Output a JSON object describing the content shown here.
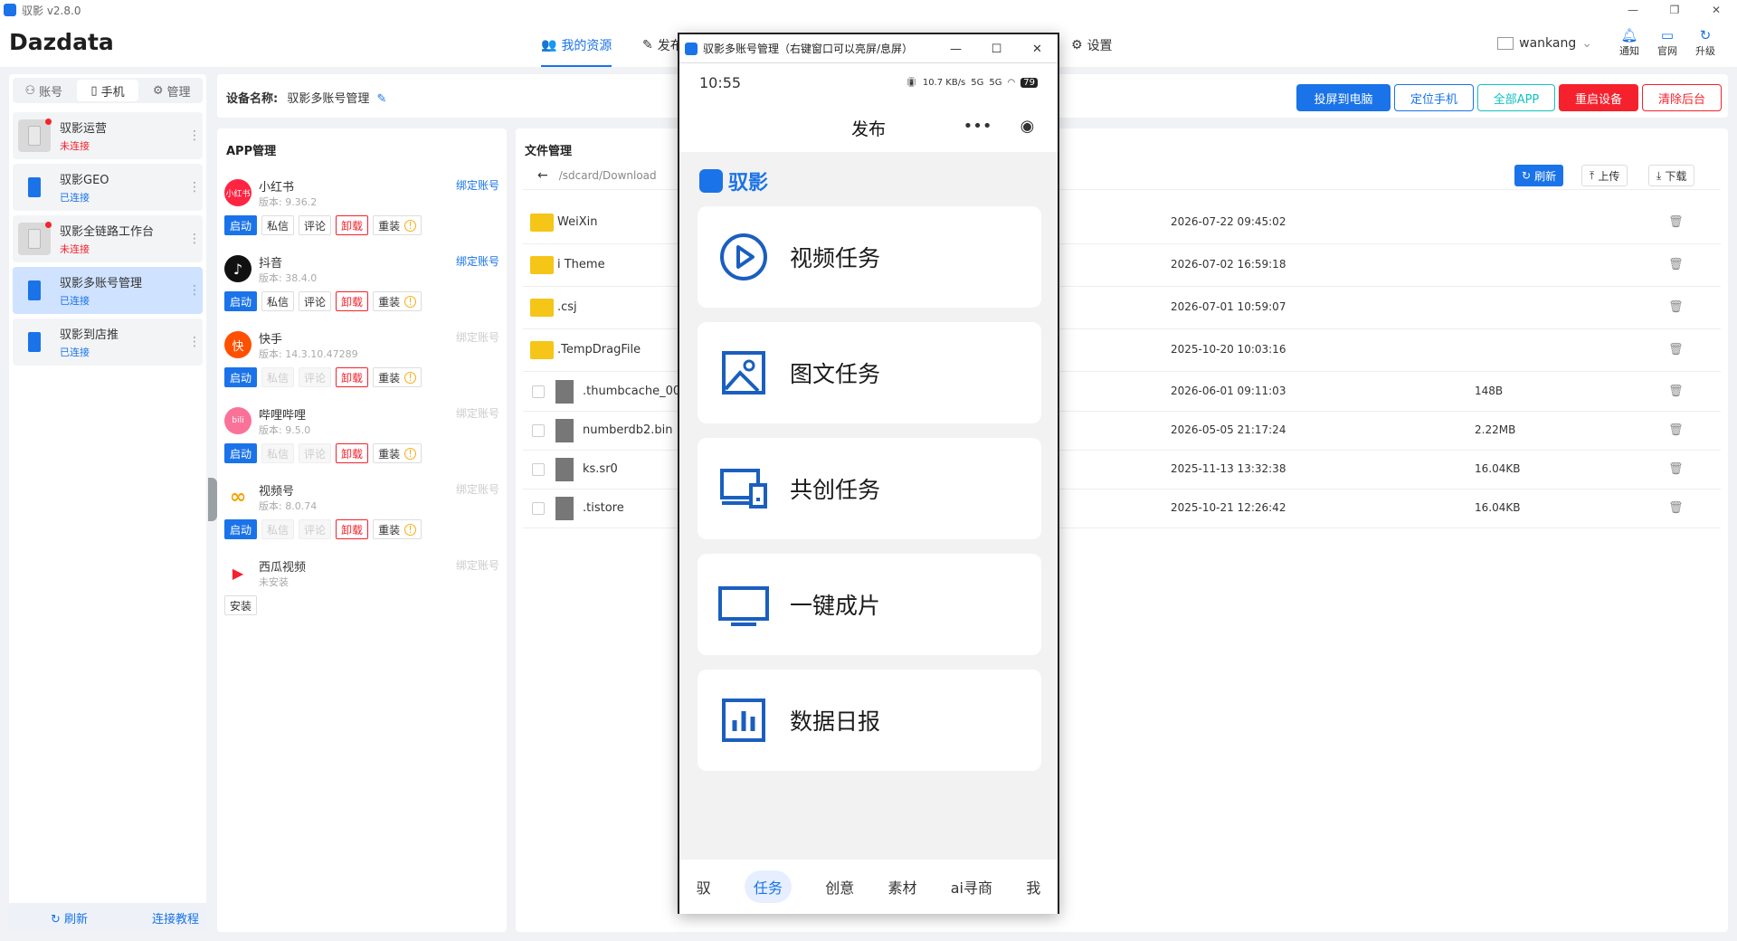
{
  "window": {
    "title": "驭影 v2.8.0",
    "controls": [
      "—",
      "❐",
      "✕"
    ]
  },
  "header": {
    "brand": "Dazdata",
    "nav": [
      {
        "label": "我的资源",
        "icon": "users-icon"
      },
      {
        "label": "发布",
        "icon": "publish-icon"
      },
      {
        "label": "设置",
        "icon": "gear-icon"
      }
    ],
    "user": "wankang",
    "icons": [
      {
        "label": "通知",
        "icon": "bell-icon"
      },
      {
        "label": "官网",
        "icon": "message-icon"
      },
      {
        "label": "升级",
        "icon": "refresh-icon"
      }
    ]
  },
  "left": {
    "tabs": [
      "账号",
      "手机",
      "管理"
    ],
    "devices": [
      {
        "name": "驭影运营",
        "status": "未连接",
        "online": false
      },
      {
        "name": "驭影GEO",
        "status": "已连接",
        "online": true
      },
      {
        "name": "驭影全链路工作台",
        "status": "未连接",
        "online": false
      },
      {
        "name": "驭影多账号管理",
        "status": "已连接",
        "online": true
      },
      {
        "name": "驭影到店推",
        "status": "已连接",
        "online": true
      }
    ],
    "refresh": "刷新",
    "tutorial": "连接教程"
  },
  "device_bar": {
    "label": "设备名称:",
    "name": "驭影多账号管理",
    "buttons": [
      "投屏到电脑",
      "定位手机",
      "全部APP",
      "重启设备",
      "清除后台"
    ]
  },
  "apps": {
    "title": "APP管理",
    "items": [
      {
        "name": "小红书",
        "version": "版本: 9.36.2",
        "bind": "绑定账号",
        "icon_text": "小红书"
      },
      {
        "name": "抖音",
        "version": "版本: 38.4.0",
        "bind": "绑定账号",
        "icon_text": "♪"
      },
      {
        "name": "快手",
        "version": "版本: 14.3.10.47289",
        "bind": "绑定账号",
        "icon_text": "快"
      },
      {
        "name": "哔哩哔哩",
        "version": "版本: 9.5.0",
        "bind": "绑定账号",
        "icon_text": "bili"
      },
      {
        "name": "视频号",
        "version": "版本: 8.0.74",
        "bind": "绑定账号",
        "icon_text": "∞"
      },
      {
        "name": "西瓜视频",
        "version": "未安装",
        "bind": "绑定账号",
        "icon_text": "▶"
      }
    ],
    "buttons": {
      "start": "启动",
      "dm": "私信",
      "comment": "评论",
      "uninstall": "卸载",
      "reinstall": "重装",
      "install": "安装"
    }
  },
  "files": {
    "title": "文件管理",
    "path": "/sdcard/Download",
    "refresh": "刷新",
    "upload": "上传",
    "download": "下载",
    "rows": [
      {
        "name": "WeiXin",
        "date": "2026-07-22 09:45:02",
        "size": "",
        "folder": true
      },
      {
        "name": "i Theme",
        "date": "2026-07-02 16:59:18",
        "size": "",
        "folder": true
      },
      {
        "name": ".csj",
        "date": "2026-07-01 10:59:07",
        "size": "",
        "folder": true
      },
      {
        "name": ".TempDragFile",
        "date": "2025-10-20 10:03:16",
        "size": "",
        "folder": true
      },
      {
        "name": ".thumbcache_00",
        "date": "2026-06-01 09:11:03",
        "size": "148B",
        "folder": false
      },
      {
        "name": "numberdb2.bin",
        "date": "2026-05-05 21:17:24",
        "size": "2.22MB",
        "folder": false
      },
      {
        "name": "ks.sr0",
        "date": "2025-11-13 13:32:38",
        "size": "16.04KB",
        "folder": false
      },
      {
        "name": ".tistore",
        "date": "2025-10-21 12:26:42",
        "size": "16.04KB",
        "folder": false
      }
    ]
  },
  "phone": {
    "window_title": "驭影多账号管理（右键窗口可以亮屏/息屏）",
    "time": "10:55",
    "net": "10.7 KB/s",
    "sig1": "5G",
    "sig2": "5G",
    "battery": "79",
    "page_title": "发布",
    "logo_text": "驭影",
    "cards": [
      {
        "label": "视频任务",
        "icon": "play-circle-icon"
      },
      {
        "label": "图文任务",
        "icon": "image-icon"
      },
      {
        "label": "共创任务",
        "icon": "devices-icon"
      },
      {
        "label": "一键成片",
        "icon": "monitor-icon"
      },
      {
        "label": "数据日报",
        "icon": "bar-chart-icon"
      }
    ],
    "tabs": [
      "驭",
      "任务",
      "创意",
      "素材",
      "ai寻商",
      "我"
    ],
    "active_tab": "任务",
    "accent": "#1a73e8"
  }
}
